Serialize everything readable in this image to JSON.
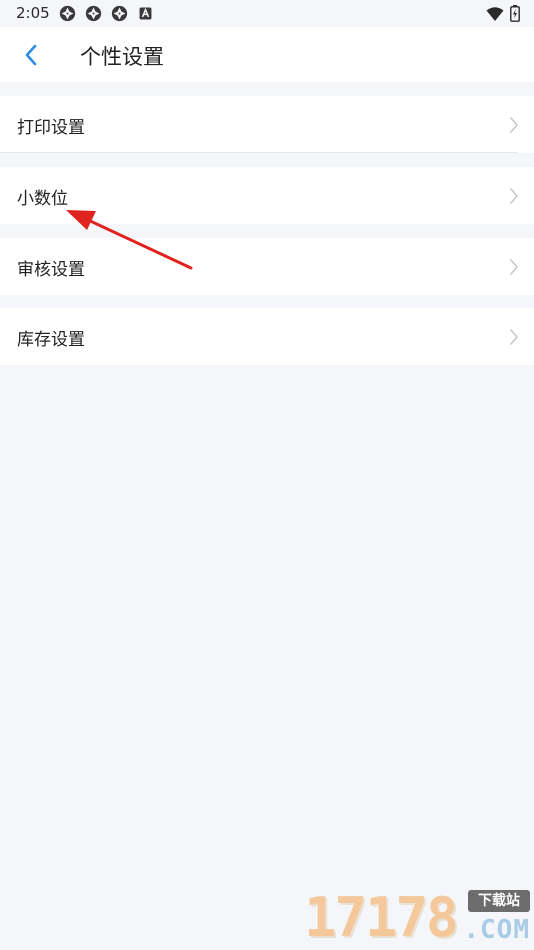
{
  "status_bar": {
    "time": "2:05",
    "notification_icons": [
      "aperture-icon",
      "aperture-icon",
      "aperture-icon",
      "a-box-icon"
    ],
    "right_icons": [
      "wifi-icon",
      "battery-charging-icon"
    ]
  },
  "header": {
    "title": "个性设置",
    "back_icon": "chevron-left-icon",
    "accent_color": "#2e8be6"
  },
  "menu": {
    "items": [
      {
        "label": "打印设置"
      },
      {
        "label": "小数位"
      },
      {
        "label": "审核设置"
      },
      {
        "label": "库存设置"
      }
    ],
    "chevron_icon": "chevron-right-icon"
  },
  "annotation": {
    "color": "#e0231f"
  },
  "watermark": {
    "digits": "17178",
    "tag": "下载站",
    "suffix": ".COM"
  }
}
